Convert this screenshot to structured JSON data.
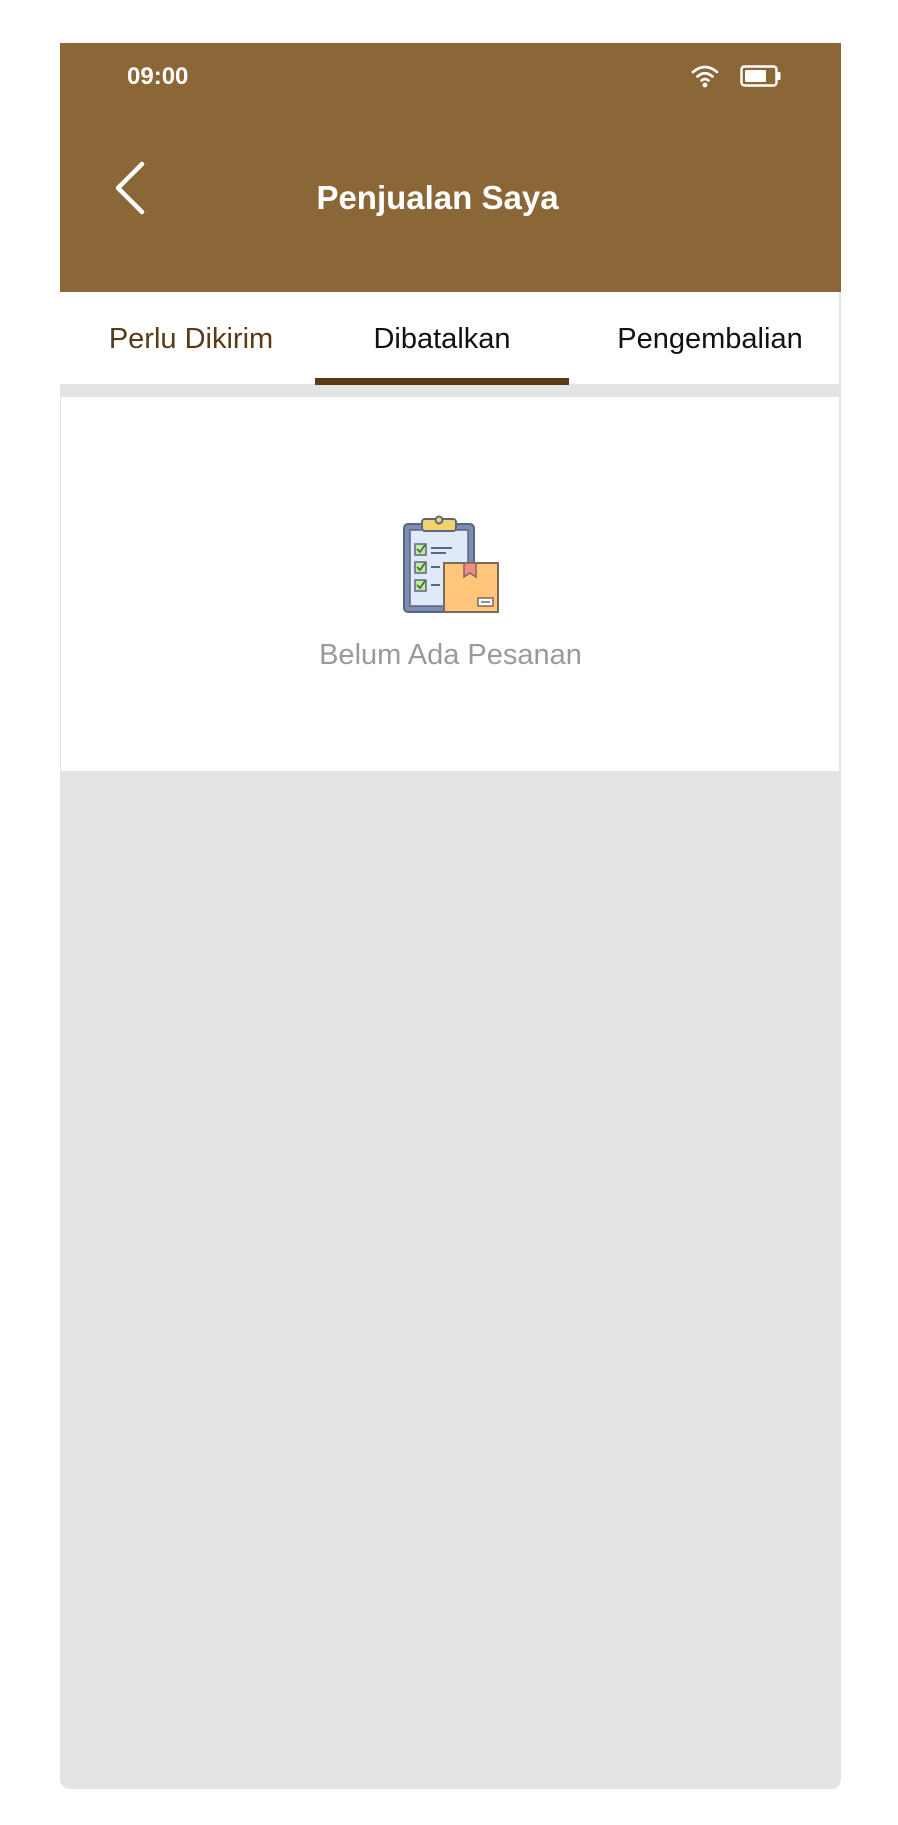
{
  "status_bar": {
    "time": "09:00",
    "icons": [
      "wifi-icon",
      "battery-icon"
    ]
  },
  "header": {
    "title": "Penjualan Saya",
    "back_icon": "chevron-left-icon"
  },
  "tabs": [
    {
      "label": "Perlu Dikirim",
      "selected": false
    },
    {
      "label": "Dibatalkan",
      "selected": true
    },
    {
      "label": "Pengembalian",
      "selected": false
    }
  ],
  "empty_state": {
    "icon": "clipboard-box-icon",
    "message": "Belum Ada Pesanan"
  },
  "colors": {
    "header_bg": "#8b6737",
    "tab_accent": "#5a3a17",
    "page_bg": "#e4e4e4",
    "muted_text": "#9a9a9a"
  }
}
